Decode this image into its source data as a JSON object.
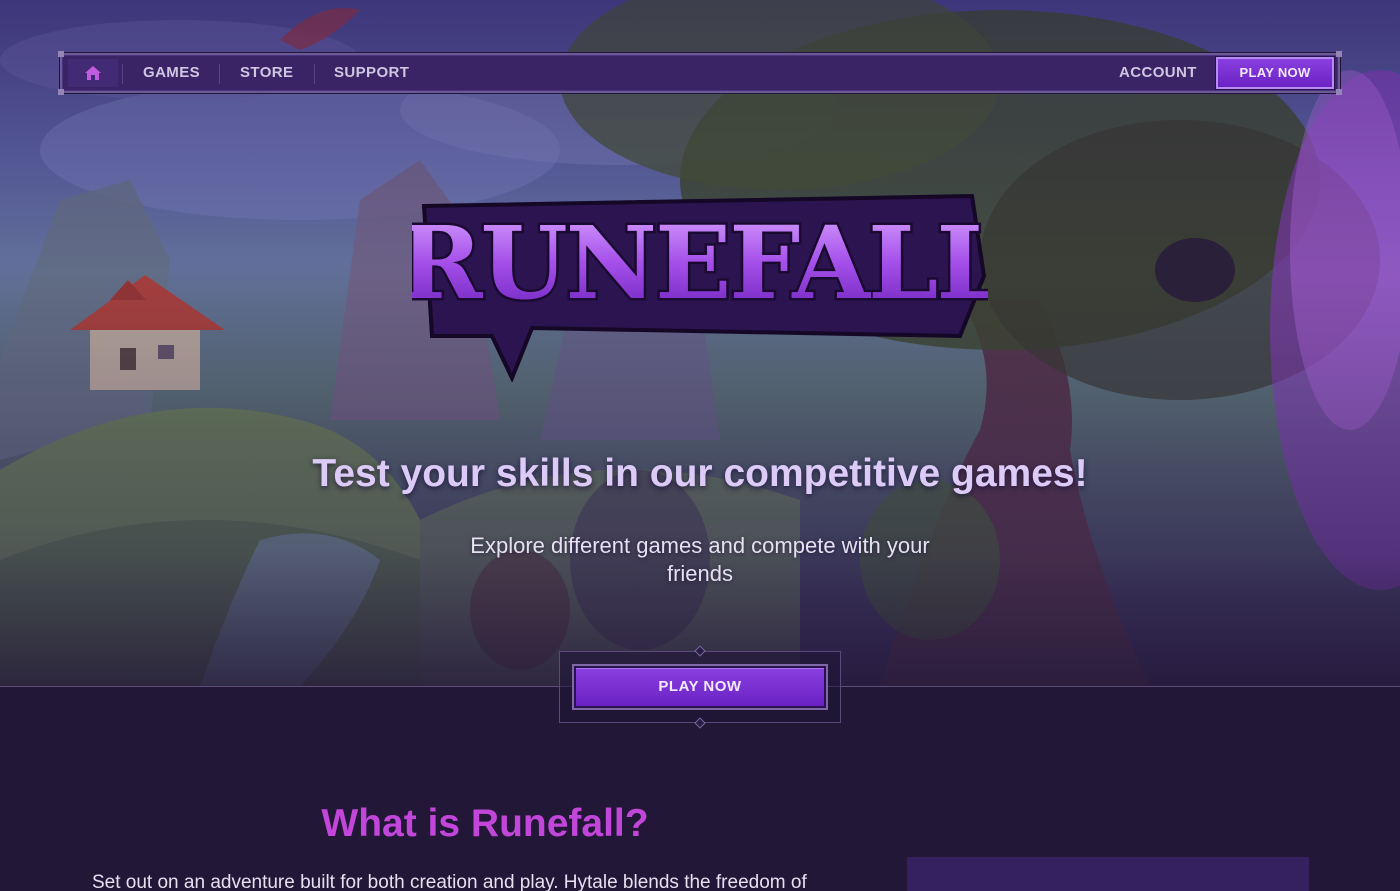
{
  "nav": {
    "home_icon": "home-icon",
    "items": [
      {
        "label": "GAMES"
      },
      {
        "label": "STORE"
      },
      {
        "label": "SUPPORT"
      }
    ],
    "account_label": "ACCOUNT",
    "play_label": "PLAY NOW"
  },
  "hero": {
    "logo_text": "RUNEFALL",
    "headline": "Test your skills in our competitive games!",
    "subline": "Explore different games and compete with your friends",
    "cta_label": "PLAY NOW"
  },
  "about": {
    "title": "What is Runefall?",
    "text": "Set out on an adventure built for both creation and play. Hytale blends the freedom of"
  },
  "colors": {
    "accent": "#7a2fd6",
    "title": "#c246d9",
    "background": "#221736"
  }
}
